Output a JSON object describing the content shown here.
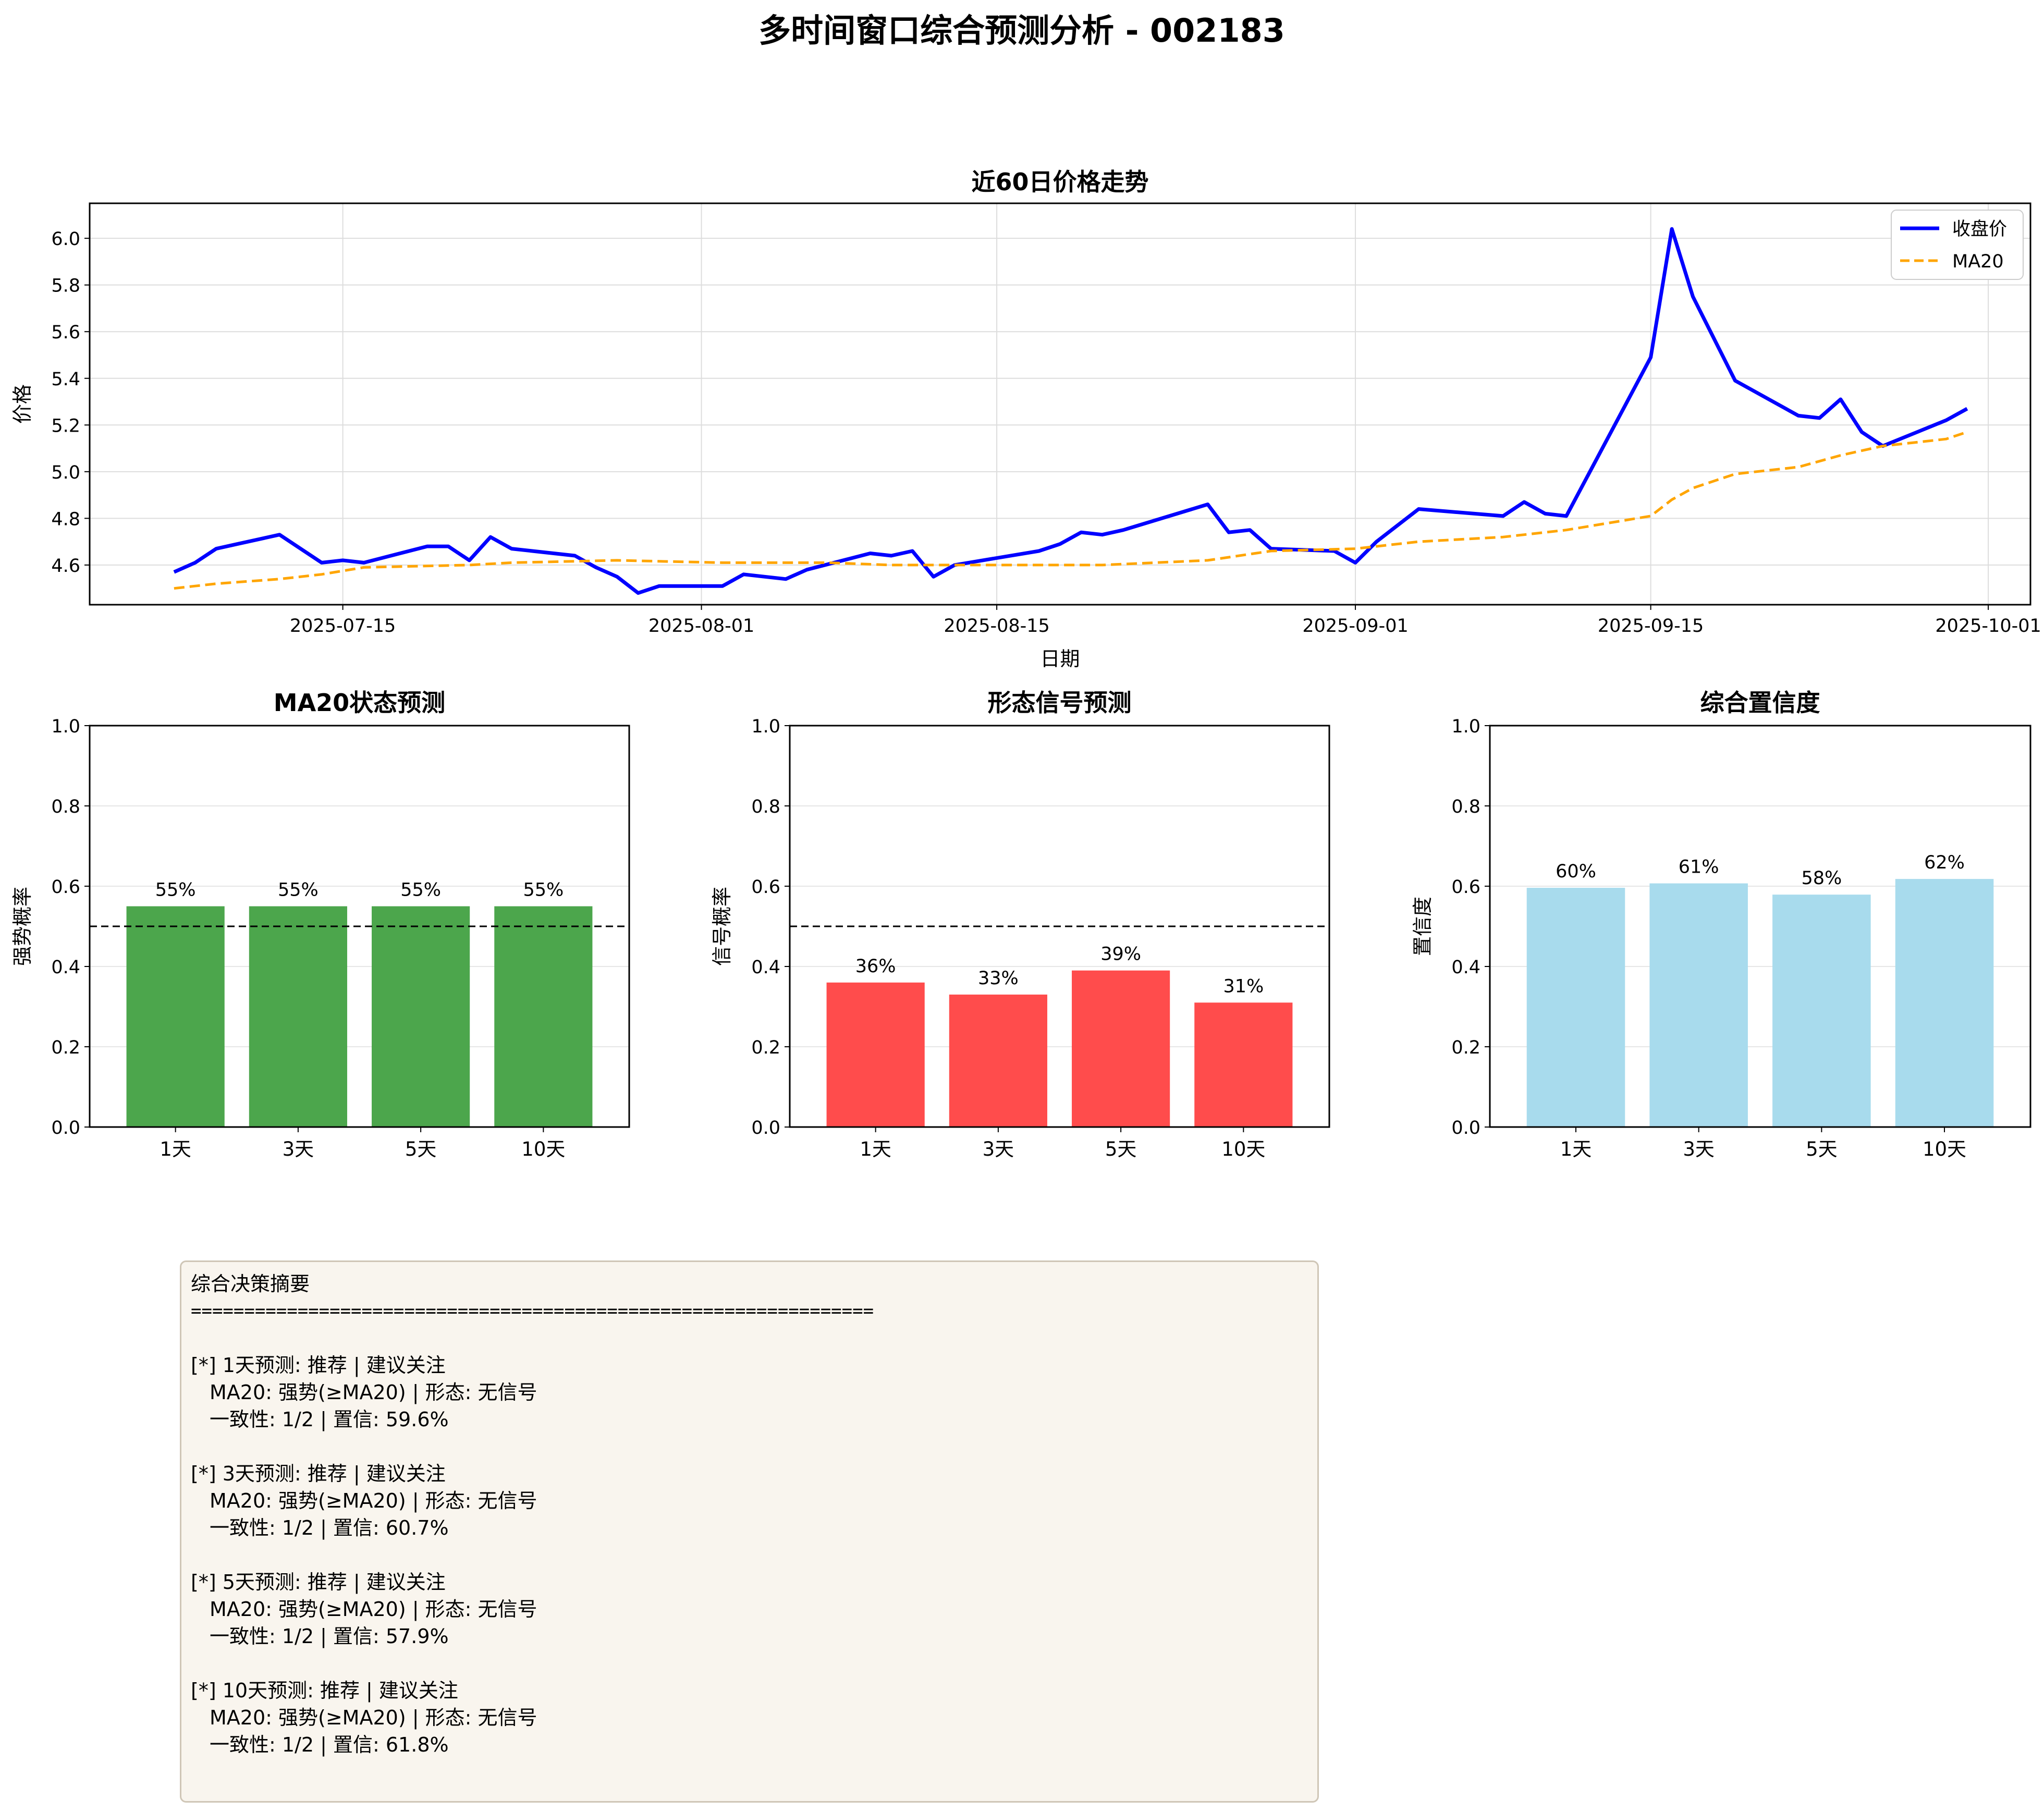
{
  "suptitle": "多时间窗口综合预测分析 - 002183",
  "colors": {
    "close": "#0000ff",
    "ma20": "#ffa500",
    "ma20_bars": "#4ca64c",
    "signal_bars": "#ff4c4c",
    "confidence_bars": "#a8dbed",
    "summary_bg": "#f9f5ee"
  },
  "chart_data": [
    {
      "id": "price",
      "type": "line",
      "title": "近60日价格走势",
      "xlabel": "日期",
      "ylabel": "价格",
      "ylim": [
        4.43,
        6.15
      ],
      "y_ticks": [
        4.6,
        4.8,
        5.0,
        5.2,
        5.4,
        5.6,
        5.8,
        6.0
      ],
      "x_range": [
        "2025-07-03",
        "2025-10-03"
      ],
      "x_ticks": [
        "2025-07-15",
        "2025-08-01",
        "2025-08-15",
        "2025-09-01",
        "2025-09-15",
        "2025-10-01"
      ],
      "grid": true,
      "legend": "top-right",
      "series": [
        {
          "name": "收盘价",
          "style": "solid",
          "points": [
            [
              "2025-07-07",
              4.57
            ],
            [
              "2025-07-08",
              4.61
            ],
            [
              "2025-07-09",
              4.67
            ],
            [
              "2025-07-10",
              4.69
            ],
            [
              "2025-07-11",
              4.71
            ],
            [
              "2025-07-12",
              4.73
            ],
            [
              "2025-07-14",
              4.61
            ],
            [
              "2025-07-15",
              4.62
            ],
            [
              "2025-07-16",
              4.61
            ],
            [
              "2025-07-19",
              4.68
            ],
            [
              "2025-07-20",
              4.68
            ],
            [
              "2025-07-21",
              4.62
            ],
            [
              "2025-07-22",
              4.72
            ],
            [
              "2025-07-23",
              4.67
            ],
            [
              "2025-07-26",
              4.64
            ],
            [
              "2025-07-27",
              4.59
            ],
            [
              "2025-07-28",
              4.55
            ],
            [
              "2025-07-29",
              4.48
            ],
            [
              "2025-07-30",
              4.51
            ],
            [
              "2025-08-02",
              4.51
            ],
            [
              "2025-08-03",
              4.56
            ],
            [
              "2025-08-05",
              4.54
            ],
            [
              "2025-08-06",
              4.58
            ],
            [
              "2025-08-09",
              4.65
            ],
            [
              "2025-08-10",
              4.64
            ],
            [
              "2025-08-11",
              4.66
            ],
            [
              "2025-08-12",
              4.55
            ],
            [
              "2025-08-13",
              4.6
            ],
            [
              "2025-08-17",
              4.66
            ],
            [
              "2025-08-18",
              4.69
            ],
            [
              "2025-08-19",
              4.74
            ],
            [
              "2025-08-20",
              4.73
            ],
            [
              "2025-08-21",
              4.75
            ],
            [
              "2025-08-25",
              4.86
            ],
            [
              "2025-08-26",
              4.74
            ],
            [
              "2025-08-27",
              4.75
            ],
            [
              "2025-08-28",
              4.67
            ],
            [
              "2025-08-31",
              4.66
            ],
            [
              "2025-09-01",
              4.61
            ],
            [
              "2025-09-02",
              4.7
            ],
            [
              "2025-09-04",
              4.84
            ],
            [
              "2025-09-08",
              4.81
            ],
            [
              "2025-09-09",
              4.87
            ],
            [
              "2025-09-10",
              4.82
            ],
            [
              "2025-09-11",
              4.81
            ],
            [
              "2025-09-15",
              5.49
            ],
            [
              "2025-09-16",
              6.04
            ],
            [
              "2025-09-17",
              5.75
            ],
            [
              "2025-09-19",
              5.39
            ],
            [
              "2025-09-22",
              5.24
            ],
            [
              "2025-09-23",
              5.23
            ],
            [
              "2025-09-24",
              5.31
            ],
            [
              "2025-09-25",
              5.17
            ],
            [
              "2025-09-26",
              5.11
            ],
            [
              "2025-09-29",
              5.22
            ],
            [
              "2025-09-30",
              5.27
            ]
          ]
        },
        {
          "name": "MA20",
          "style": "dashed",
          "points": [
            [
              "2025-07-07",
              4.5
            ],
            [
              "2025-07-08",
              4.51
            ],
            [
              "2025-07-09",
              4.52
            ],
            [
              "2025-07-12",
              4.54
            ],
            [
              "2025-07-14",
              4.56
            ],
            [
              "2025-07-16",
              4.59
            ],
            [
              "2025-07-21",
              4.6
            ],
            [
              "2025-07-23",
              4.61
            ],
            [
              "2025-07-28",
              4.62
            ],
            [
              "2025-08-02",
              4.61
            ],
            [
              "2025-08-07",
              4.61
            ],
            [
              "2025-08-10",
              4.6
            ],
            [
              "2025-08-17",
              4.6
            ],
            [
              "2025-08-20",
              4.6
            ],
            [
              "2025-08-25",
              4.62
            ],
            [
              "2025-08-28",
              4.66
            ],
            [
              "2025-09-01",
              4.67
            ],
            [
              "2025-09-04",
              4.7
            ],
            [
              "2025-09-08",
              4.72
            ],
            [
              "2025-09-11",
              4.75
            ],
            [
              "2025-09-15",
              4.81
            ],
            [
              "2025-09-16",
              4.88
            ],
            [
              "2025-09-17",
              4.93
            ],
            [
              "2025-09-19",
              4.99
            ],
            [
              "2025-09-22",
              5.02
            ],
            [
              "2025-09-24",
              5.07
            ],
            [
              "2025-09-26",
              5.11
            ],
            [
              "2025-09-29",
              5.14
            ],
            [
              "2025-09-30",
              5.17
            ]
          ]
        }
      ]
    },
    {
      "id": "ma20_state",
      "type": "bar",
      "title": "MA20状态预测",
      "ylabel": "强势概率",
      "categories": [
        "1天",
        "3天",
        "5天",
        "10天"
      ],
      "values": [
        0.55,
        0.55,
        0.55,
        0.55
      ],
      "data_labels": [
        "55%",
        "55%",
        "55%",
        "55%"
      ],
      "ylim": [
        0,
        1
      ],
      "y_ticks": [
        0.0,
        0.2,
        0.4,
        0.6,
        0.8,
        1.0
      ],
      "y_tick_labels": [
        "0.0",
        "0.2",
        "0.4",
        "0.6",
        "0.8",
        "1.0"
      ],
      "reference_line": 0.5,
      "grid": true
    },
    {
      "id": "pattern_signal",
      "type": "bar",
      "title": "形态信号预测",
      "ylabel": "信号概率",
      "categories": [
        "1天",
        "3天",
        "5天",
        "10天"
      ],
      "values": [
        0.36,
        0.33,
        0.39,
        0.31
      ],
      "data_labels": [
        "36%",
        "33%",
        "39%",
        "31%"
      ],
      "ylim": [
        0,
        1
      ],
      "y_ticks": [
        0.0,
        0.2,
        0.4,
        0.6,
        0.8,
        1.0
      ],
      "y_tick_labels": [
        "0.0",
        "0.2",
        "0.4",
        "0.6",
        "0.8",
        "1.0"
      ],
      "reference_line": 0.5,
      "grid": true
    },
    {
      "id": "confidence",
      "type": "bar",
      "title": "综合置信度",
      "ylabel": "置信度",
      "categories": [
        "1天",
        "3天",
        "5天",
        "10天"
      ],
      "values": [
        0.596,
        0.607,
        0.579,
        0.618
      ],
      "data_labels": [
        "60%",
        "61%",
        "58%",
        "62%"
      ],
      "ylim": [
        0,
        1
      ],
      "y_ticks": [
        0.0,
        0.2,
        0.4,
        0.6,
        0.8,
        1.0
      ],
      "y_tick_labels": [
        "0.0",
        "0.2",
        "0.4",
        "0.6",
        "0.8",
        "1.0"
      ],
      "grid": true
    }
  ],
  "summary": {
    "title": "综合决策摘要",
    "rule": "================================================================",
    "blocks": [
      {
        "head": "[*] 1天预测: 推荐 | 建议关注",
        "ma_line": "MA20: 强势(≥MA20) | 形态: 无信号",
        "conf_line": "一致性: 1/2 | 置信: 59.6%"
      },
      {
        "head": "[*] 3天预测: 推荐 | 建议关注",
        "ma_line": "MA20: 强势(≥MA20) | 形态: 无信号",
        "conf_line": "一致性: 1/2 | 置信: 60.7%"
      },
      {
        "head": "[*] 5天预测: 推荐 | 建议关注",
        "ma_line": "MA20: 强势(≥MA20) | 形态: 无信号",
        "conf_line": "一致性: 1/2 | 置信: 57.9%"
      },
      {
        "head": "[*] 10天预测: 推荐 | 建议关注",
        "ma_line": "MA20: 强势(≥MA20) | 形态: 无信号",
        "conf_line": "一致性: 1/2 | 置信: 61.8%"
      }
    ]
  }
}
